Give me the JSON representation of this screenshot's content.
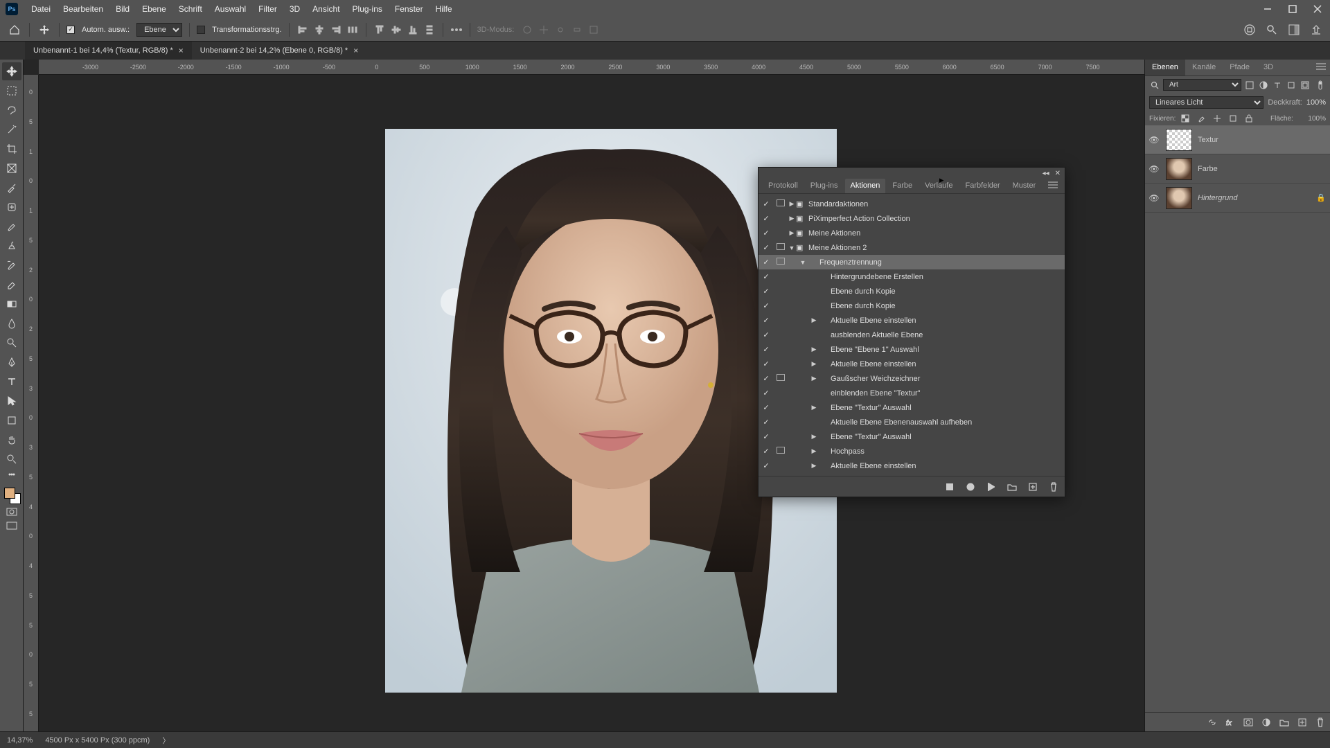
{
  "menu": {
    "items": [
      "Datei",
      "Bearbeiten",
      "Bild",
      "Ebene",
      "Schrift",
      "Auswahl",
      "Filter",
      "3D",
      "Ansicht",
      "Plug-ins",
      "Fenster",
      "Hilfe"
    ]
  },
  "options": {
    "auto_select_label": "Autom. ausw.:",
    "layer_select": "Ebene",
    "transform_label": "Transformationsstrg.",
    "mode3d_label": "3D-Modus:"
  },
  "doc_tabs": [
    {
      "title": "Unbenannt-1 bei 14,4% (Textur, RGB/8) *",
      "active": true
    },
    {
      "title": "Unbenannt-2 bei 14,2% (Ebene 0, RGB/8) *",
      "active": false
    }
  ],
  "ruler_h": [
    "-3000",
    "-2500",
    "-2000",
    "-1500",
    "-1000",
    "-500",
    "0",
    "500",
    "1000",
    "1500",
    "2000",
    "2500",
    "3000",
    "3500",
    "4000",
    "4500",
    "5000",
    "5500",
    "6000",
    "6500",
    "7000",
    "7500"
  ],
  "ruler_v": [
    "0",
    "5",
    "1",
    "0",
    "1",
    "5",
    "2",
    "0",
    "2",
    "5",
    "3",
    "0",
    "3",
    "5",
    "4",
    "0",
    "4",
    "5",
    "5",
    "0",
    "5",
    "5"
  ],
  "actions_panel": {
    "tabs": [
      "Protokoll",
      "Plug-ins",
      "Aktionen",
      "Farbe",
      "Verlaufe",
      "Farbfelder",
      "Muster"
    ],
    "active_tab": "Aktionen",
    "rows": [
      {
        "check": true,
        "dlg": true,
        "indent": 0,
        "expand": "▶",
        "folder": true,
        "label": "Standardaktionen",
        "sel": false
      },
      {
        "check": true,
        "dlg": false,
        "indent": 0,
        "expand": "▶",
        "folder": true,
        "label": "PiXimperfect Action Collection",
        "sel": false
      },
      {
        "check": true,
        "dlg": false,
        "indent": 0,
        "expand": "▶",
        "folder": true,
        "label": "Meine Aktionen",
        "sel": false
      },
      {
        "check": true,
        "dlg": true,
        "indent": 0,
        "expand": "▼",
        "folder": true,
        "label": "Meine Aktionen 2",
        "sel": false
      },
      {
        "check": true,
        "dlg": true,
        "indent": 1,
        "expand": "▼",
        "folder": false,
        "label": "Frequenztrennung",
        "sel": true
      },
      {
        "check": true,
        "dlg": false,
        "indent": 2,
        "expand": "",
        "folder": false,
        "label": "Hintergrundebene Erstellen",
        "sel": false
      },
      {
        "check": true,
        "dlg": false,
        "indent": 2,
        "expand": "",
        "folder": false,
        "label": "Ebene durch Kopie",
        "sel": false
      },
      {
        "check": true,
        "dlg": false,
        "indent": 2,
        "expand": "",
        "folder": false,
        "label": "Ebene durch Kopie",
        "sel": false
      },
      {
        "check": true,
        "dlg": false,
        "indent": 2,
        "expand": "▶",
        "folder": false,
        "label": "Aktuelle Ebene einstellen",
        "sel": false
      },
      {
        "check": true,
        "dlg": false,
        "indent": 2,
        "expand": "",
        "folder": false,
        "label": "ausblenden Aktuelle Ebene",
        "sel": false
      },
      {
        "check": true,
        "dlg": false,
        "indent": 2,
        "expand": "▶",
        "folder": false,
        "label": "Ebene \"Ebene 1\" Auswahl",
        "sel": false
      },
      {
        "check": true,
        "dlg": false,
        "indent": 2,
        "expand": "▶",
        "folder": false,
        "label": "Aktuelle Ebene einstellen",
        "sel": false
      },
      {
        "check": true,
        "dlg": true,
        "indent": 2,
        "expand": "▶",
        "folder": false,
        "label": "Gaußscher Weichzeichner",
        "sel": false
      },
      {
        "check": true,
        "dlg": false,
        "indent": 2,
        "expand": "",
        "folder": false,
        "label": "einblenden Ebene \"Textur\"",
        "sel": false
      },
      {
        "check": true,
        "dlg": false,
        "indent": 2,
        "expand": "▶",
        "folder": false,
        "label": "Ebene \"Textur\" Auswahl",
        "sel": false
      },
      {
        "check": true,
        "dlg": false,
        "indent": 2,
        "expand": "",
        "folder": false,
        "label": "Aktuelle Ebene Ebenenauswahl aufheben",
        "sel": false
      },
      {
        "check": true,
        "dlg": false,
        "indent": 2,
        "expand": "▶",
        "folder": false,
        "label": "Ebene \"Textur\" Auswahl",
        "sel": false
      },
      {
        "check": true,
        "dlg": true,
        "indent": 2,
        "expand": "▶",
        "folder": false,
        "label": "Hochpass",
        "sel": false
      },
      {
        "check": true,
        "dlg": false,
        "indent": 2,
        "expand": "▶",
        "folder": false,
        "label": "Aktuelle Ebene einstellen",
        "sel": false
      }
    ]
  },
  "layers_panel": {
    "tabs": [
      "Ebenen",
      "Kanäle",
      "Pfade",
      "3D"
    ],
    "active_tab": "Ebenen",
    "search_placeholder": "Art",
    "blend_mode": "Lineares Licht",
    "opacity_label": "Deckkraft:",
    "opacity": "100%",
    "fixieren_label": "Fixieren:",
    "fill_label": "Fläche:",
    "fill": "100%",
    "layers": [
      {
        "name": "Textur",
        "sel": true,
        "thumb": "txtr",
        "locked": false,
        "italic": false
      },
      {
        "name": "Farbe",
        "sel": false,
        "thumb": "photo",
        "locked": false,
        "italic": false
      },
      {
        "name": "Hintergrund",
        "sel": false,
        "thumb": "photo",
        "locked": true,
        "italic": true
      }
    ]
  },
  "status": {
    "zoom": "14,37%",
    "info": "4500 Px x 5400 Px (300 ppcm)"
  },
  "colors": {
    "fg": "#e0b080",
    "bg": "#ffffff"
  }
}
